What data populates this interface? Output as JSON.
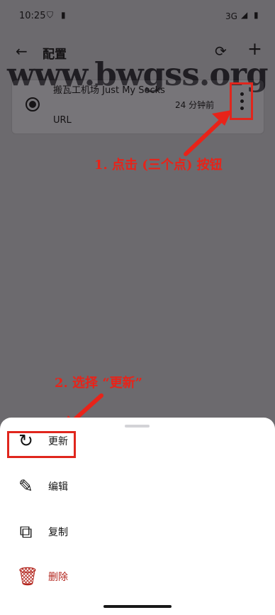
{
  "status": {
    "time": "10:25",
    "network": "3G"
  },
  "header": {
    "title": "配置"
  },
  "watermark": "www.bwgss.org",
  "config": {
    "name": "搬瓦工机场 Just My Socks",
    "type": "URL",
    "updated": "24 分钟前"
  },
  "annotations": {
    "step1": "1. 点击 (三个点)  按钮",
    "step2": "2. 选择 “更新”"
  },
  "sheet": {
    "items": [
      {
        "label": "更新",
        "icon": "update-icon"
      },
      {
        "label": "编辑",
        "icon": "edit-icon"
      },
      {
        "label": "复制",
        "icon": "copy-icon"
      },
      {
        "label": "删除",
        "icon": "delete-icon"
      }
    ]
  },
  "colors": {
    "overlay": "#6c6a6e",
    "annotation_red": "#e82319",
    "delete_red": "#b3261e"
  }
}
